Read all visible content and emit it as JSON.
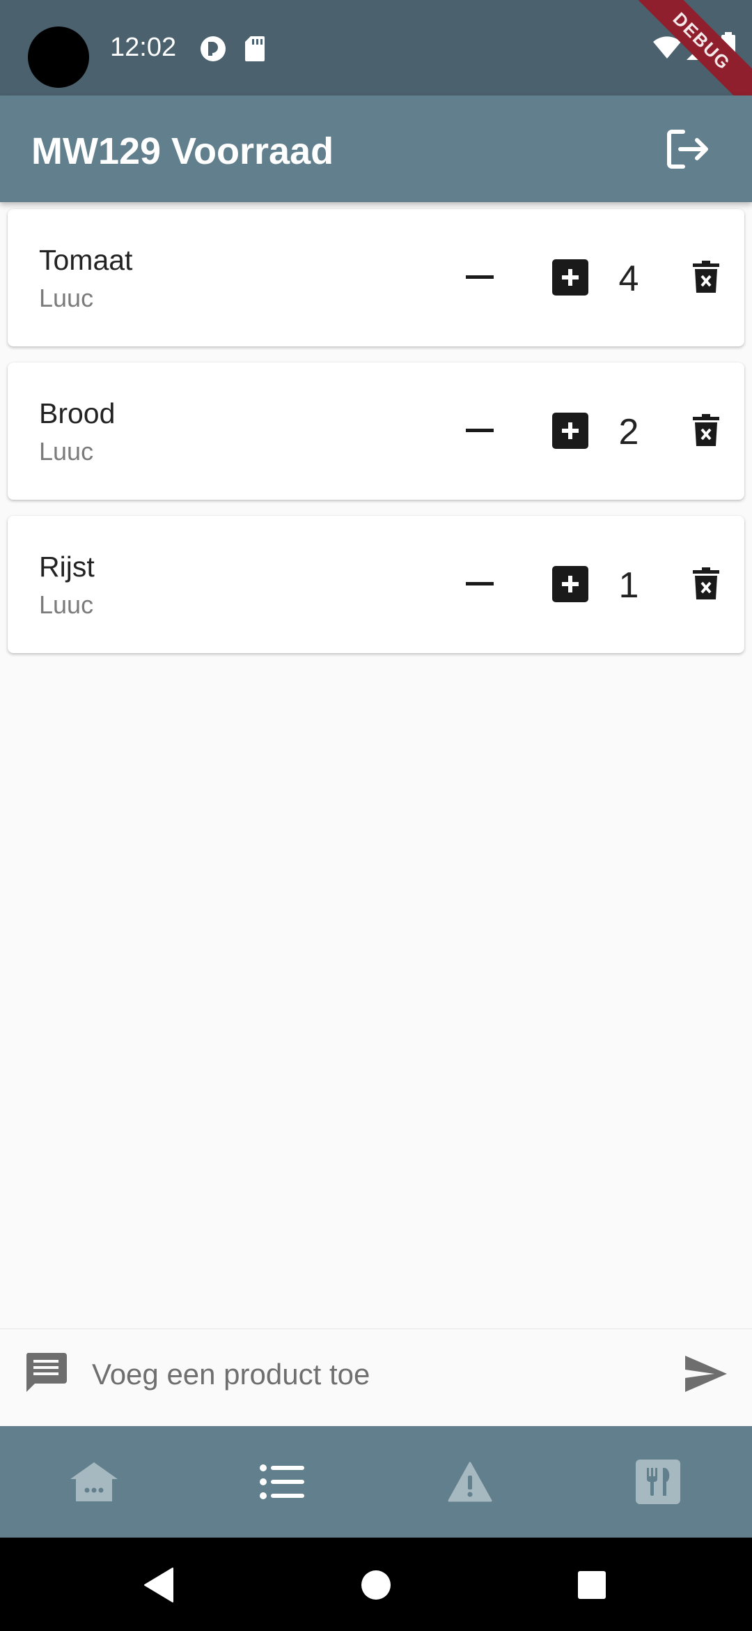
{
  "status_bar": {
    "time": "12:02",
    "debug_banner": "DEBUG",
    "icons": [
      "pin-icon",
      "sd-card-icon",
      "wifi-icon",
      "signal-icon",
      "battery-icon"
    ]
  },
  "app_bar": {
    "title": "MW129 Voorraad",
    "action_icon": "logout-icon"
  },
  "items": [
    {
      "name": "Tomaat",
      "owner": "Luuc",
      "quantity": "4"
    },
    {
      "name": "Brood",
      "owner": "Luuc",
      "quantity": "2"
    },
    {
      "name": "Rijst",
      "owner": "Luuc",
      "quantity": "1"
    }
  ],
  "composer": {
    "placeholder": "Voeg een product toe",
    "value": "",
    "left_icon": "message-icon",
    "send_icon": "send-icon"
  },
  "bottom_nav": {
    "items": [
      {
        "icon": "house-icon",
        "active": false
      },
      {
        "icon": "list-icon",
        "active": true
      },
      {
        "icon": "warning-icon",
        "active": false
      },
      {
        "icon": "restaurant-icon",
        "active": false
      }
    ]
  },
  "system_nav": [
    "back-icon",
    "home-icon",
    "recents-icon"
  ],
  "colors": {
    "status_bar": "#4b616d",
    "app_bar": "#617f8c",
    "nav_active": "#ffffff",
    "nav_inactive": "#a6b8c0",
    "background": "#fafafa"
  }
}
